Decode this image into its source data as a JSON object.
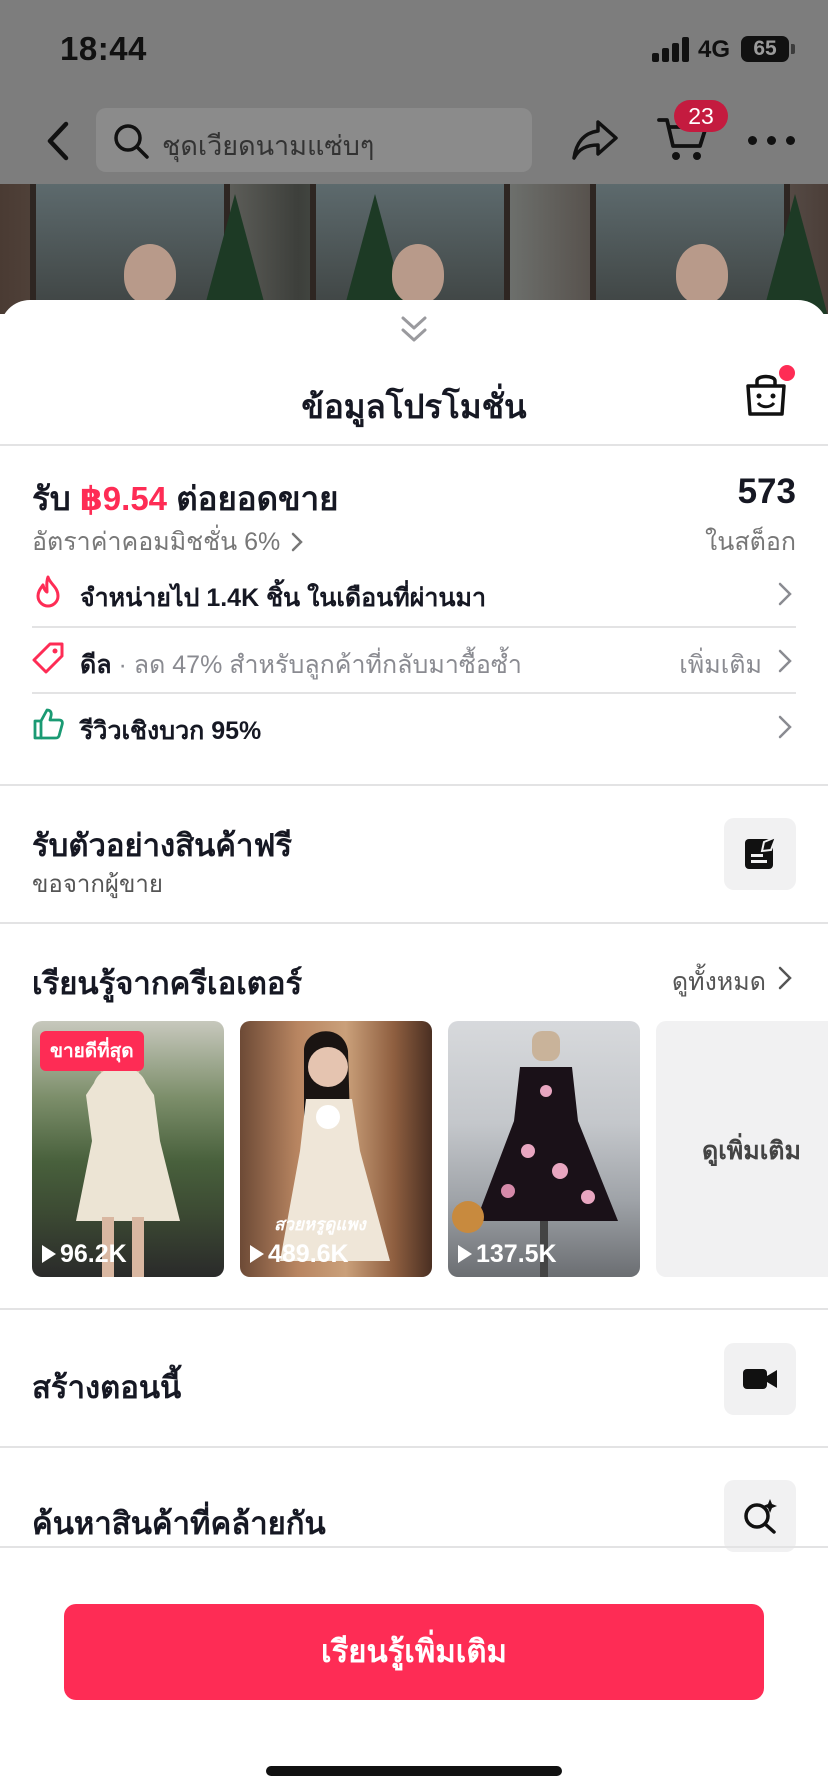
{
  "status_bar": {
    "time": "18:44",
    "network": "4G",
    "battery": "65"
  },
  "nav": {
    "search_placeholder": "ชุดเวียดนามแซ่บๆ",
    "cart_count": "23",
    "icons": [
      "back-icon",
      "search-icon",
      "share-icon",
      "cart-icon",
      "more-icon"
    ]
  },
  "sheet": {
    "title": "ข้อมูลโปรโมชั่น",
    "earn": {
      "prefix": "รับ",
      "amount": "฿9.54",
      "suffix": "ต่อยอดขาย"
    },
    "commission": "อัตราค่าคอมมิชชั่น 6%",
    "stock": {
      "count": "573",
      "label": "ในสต็อก"
    },
    "rows": [
      {
        "icon": "flame-icon",
        "text": "จำหน่ายไป 1.4K ชิ้น ในเดือนที่ผ่านมา",
        "sub": "",
        "more": ""
      },
      {
        "icon": "tag-icon",
        "text": "ดีล",
        "sub": " · ลด 47% สำหรับลูกค้าที่กลับมาซื้อซ้ำ",
        "more": "เพิ่มเติม"
      },
      {
        "icon": "thumbs-up-icon",
        "text": "รีวิวเชิงบวก 95%",
        "sub": "",
        "more": ""
      }
    ],
    "free_sample": {
      "title": "รับตัวอย่างสินค้าฟรี",
      "subtitle": "ขอจากผู้ขาย"
    },
    "creators": {
      "title": "เรียนรู้จากครีเอเตอร์",
      "see_all": "ดูทั้งหมด",
      "videos": [
        {
          "badge": "ขายดีที่สุด",
          "views": "96.2K"
        },
        {
          "badge": "",
          "views": "489.6K",
          "caption": "สวยหรูดูแพง"
        },
        {
          "badge": "",
          "views": "137.5K"
        }
      ],
      "see_more": "ดูเพิ่มเติม"
    },
    "create_now": "สร้างตอนนี้",
    "find_similar": "ค้นหาสินค้าที่คล้ายกัน",
    "cta": "เรียนรู้เพิ่มเติม"
  },
  "colors": {
    "accent": "#fe2c55",
    "positive": "#1a9a73",
    "text": "#161823",
    "muted": "#8a8b91"
  }
}
